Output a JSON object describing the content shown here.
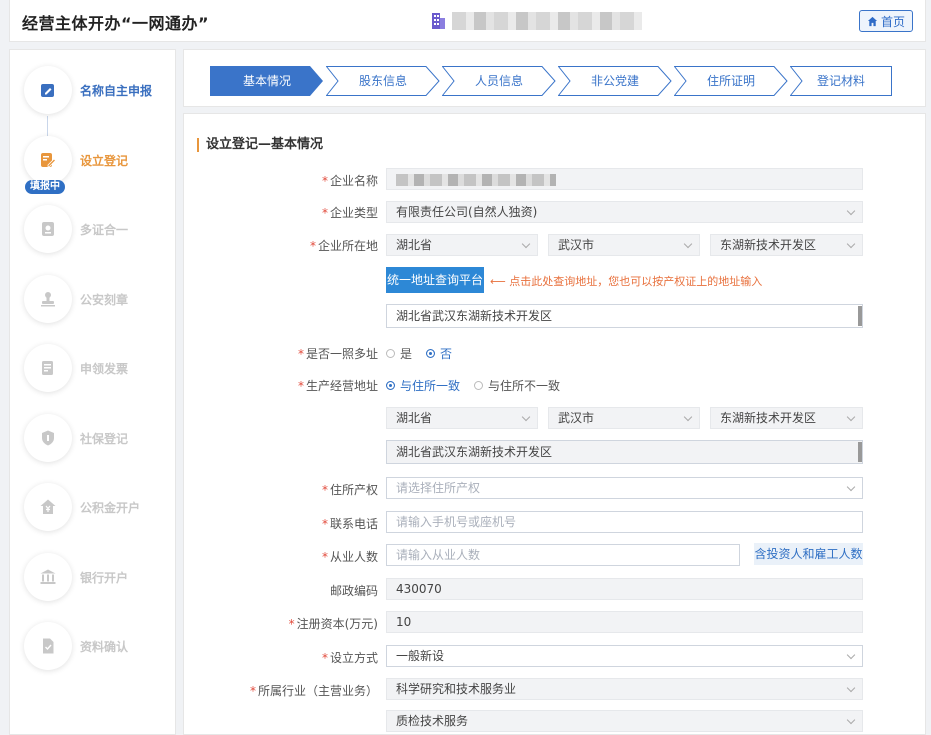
{
  "header": {
    "title": "经营主体开办“一网通办”",
    "home_label": "首页"
  },
  "sidebar": {
    "items": [
      {
        "label": "名称自主申报",
        "icon": "edit-doc-icon",
        "state": "done"
      },
      {
        "label": "设立登记",
        "icon": "pen-doc-icon",
        "state": "active"
      },
      {
        "label": "多证合一",
        "icon": "certificate-icon",
        "state": "pending"
      },
      {
        "label": "公安刻章",
        "icon": "stamp-icon",
        "state": "pending"
      },
      {
        "label": "申领发票",
        "icon": "invoice-icon",
        "state": "pending"
      },
      {
        "label": "社保登记",
        "icon": "shield-icon",
        "state": "pending"
      },
      {
        "label": "公积金开户",
        "icon": "house-yen-icon",
        "state": "pending"
      },
      {
        "label": "银行开户",
        "icon": "bank-icon",
        "state": "pending"
      },
      {
        "label": "资料确认",
        "icon": "file-check-icon",
        "state": "pending"
      }
    ],
    "filling_badge": "填报中"
  },
  "steps": [
    {
      "label": "基本情况",
      "active": true
    },
    {
      "label": "股东信息",
      "active": false
    },
    {
      "label": "人员信息",
      "active": false
    },
    {
      "label": "非公党建",
      "active": false
    },
    {
      "label": "住所证明",
      "active": false
    },
    {
      "label": "登记材料",
      "active": false
    }
  ],
  "form": {
    "section_title": "设立登记—基本情况",
    "company_name": {
      "label": "企业名称"
    },
    "company_type": {
      "label": "企业类型",
      "value": "有限责任公司(自然人独资)"
    },
    "location": {
      "label": "企业所在地",
      "province": "湖北省",
      "city": "武汉市",
      "district": "东湖新技术开发区"
    },
    "query_button": "统一地址查询平台",
    "query_hint": "点击此处查询地址，您也可以按产权证上的地址输入",
    "address_detail": "湖北省武汉东湖新技术开发区",
    "multi_address": {
      "label": "是否一照多址",
      "options": [
        "是",
        "否"
      ],
      "selected": "否"
    },
    "business_address": {
      "label": "生产经营地址",
      "options": [
        "与住所一致",
        "与住所不一致"
      ],
      "selected": "与住所一致"
    },
    "business_location": {
      "province": "湖北省",
      "city": "武汉市",
      "district": "东湖新技术开发区"
    },
    "business_address_detail": "湖北省武汉东湖新技术开发区",
    "property_right": {
      "label": "住所产权",
      "placeholder": "请选择住所产权"
    },
    "phone": {
      "label": "联系电话",
      "placeholder": "请输入手机号或座机号"
    },
    "employees": {
      "label": "从业人数",
      "placeholder": "请输入从业人数",
      "side_button": "含投资人和雇工人数"
    },
    "postal_code": {
      "label": "邮政编码",
      "value": "430070"
    },
    "capital": {
      "label": "注册资本(万元)",
      "value": "10"
    },
    "setup_method": {
      "label": "设立方式",
      "value": "一般新设"
    },
    "industry": {
      "label": "所属行业（主营业务）",
      "value": "科学研究和技术服务业",
      "sub_value": "质检技术服务"
    }
  },
  "colors": {
    "primary": "#2f6fc4",
    "active_step": "#3a74c9",
    "accent": "#e8963c",
    "required": "#e24b3c"
  }
}
